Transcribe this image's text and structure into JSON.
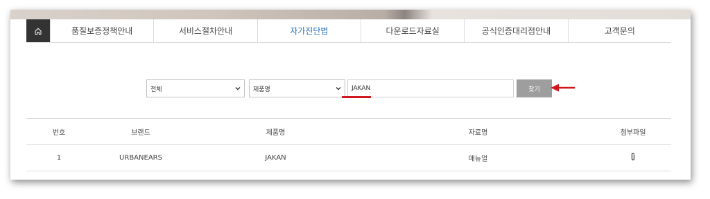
{
  "nav": {
    "home_icon": "home-icon",
    "items": [
      {
        "label": "품질보증정책안내",
        "active": false
      },
      {
        "label": "서비스절차안내",
        "active": false
      },
      {
        "label": "자가진단법",
        "active": true
      },
      {
        "label": "다운로드자료실",
        "active": false
      },
      {
        "label": "공식인증대리점안내",
        "active": false
      },
      {
        "label": "고객문의",
        "active": false
      }
    ],
    "active_color": "#2a73b8"
  },
  "search": {
    "category_select": "전체",
    "field_select": "제품명",
    "query_value": "JAKAN",
    "submit_label": "찾기",
    "highlight_color": "#d0161e"
  },
  "table": {
    "headers": [
      "번호",
      "브랜드",
      "제품명",
      "자료명",
      "첨부파일"
    ],
    "rows": [
      {
        "number": "1",
        "brand": "URBANEARS",
        "product": "JAKAN",
        "title": "매뉴얼",
        "attachment_icon": "paperclip-icon"
      }
    ]
  }
}
